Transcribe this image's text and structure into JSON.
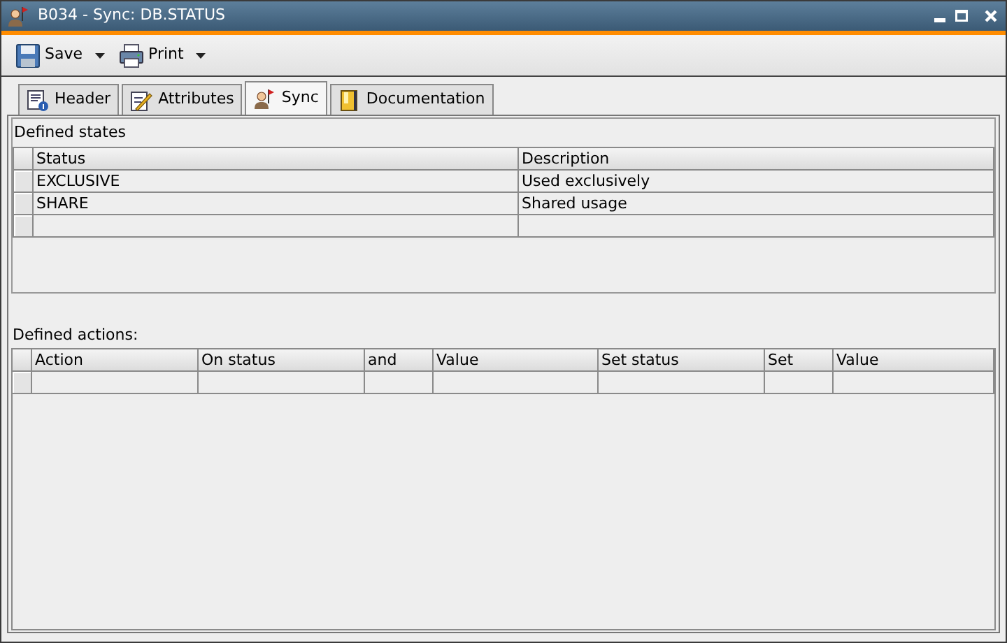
{
  "window": {
    "title": "B034 - Sync: DB.STATUS"
  },
  "toolbar": [
    {
      "label": "Save",
      "kind": "save"
    },
    {
      "label": "Print",
      "kind": "print"
    }
  ],
  "tabs": [
    {
      "label": "Header",
      "kind": "header",
      "selected": false
    },
    {
      "label": "Attributes",
      "kind": "attributes",
      "selected": false
    },
    {
      "label": "Sync",
      "kind": "sync",
      "selected": true
    },
    {
      "label": "Documentation",
      "kind": "documentation",
      "selected": false
    }
  ],
  "states": {
    "title": "Defined states",
    "columns": [
      "Status",
      "Description"
    ],
    "rows": [
      [
        "EXCLUSIVE",
        "Used exclusively"
      ],
      [
        "SHARE",
        "Shared usage"
      ]
    ]
  },
  "actions": {
    "title": "Defined actions:",
    "columns": [
      "Action",
      "On status",
      "and",
      "Value",
      "Set status",
      "Set",
      "Value"
    ]
  }
}
